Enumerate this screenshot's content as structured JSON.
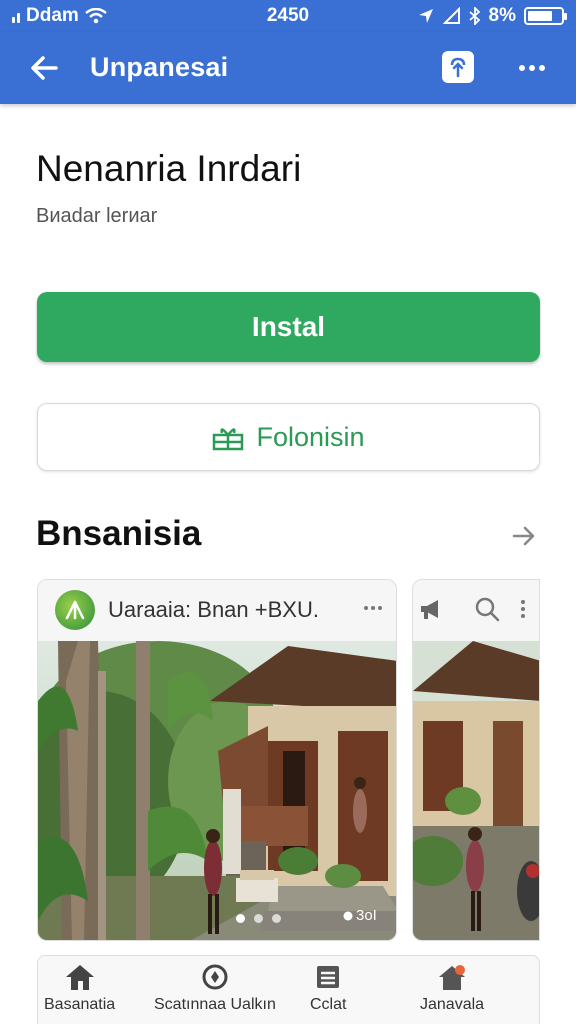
{
  "status_bar": {
    "carrier": "Ddam",
    "time": "2450",
    "battery_text": "8%",
    "battery_level": 0.75
  },
  "app_bar": {
    "title": "Unpanesai"
  },
  "header": {
    "title": "Nenanria Inrdari",
    "subtitle": "Bиadar lerиar"
  },
  "actions": {
    "install_label": "Instal",
    "follow_label": "Folonisin"
  },
  "section": {
    "title": "Bnsanisia"
  },
  "card": {
    "title": "Uaraaia: Bnan +BXU.",
    "image_counter": "3oI",
    "active_dot": 0,
    "dot_count": 3
  },
  "bottom_nav": {
    "items": [
      {
        "label": "Basanatia",
        "icon": "home-icon"
      },
      {
        "label": "Scatınnaa Ualkın",
        "icon": "compass-icon"
      },
      {
        "label": "Cclat",
        "icon": "list-icon"
      },
      {
        "label": "Janavala",
        "icon": "house-badge-icon"
      }
    ]
  },
  "colors": {
    "primary": "#3a6fd4",
    "install": "#2fa860",
    "follow_text": "#2a9a55"
  }
}
